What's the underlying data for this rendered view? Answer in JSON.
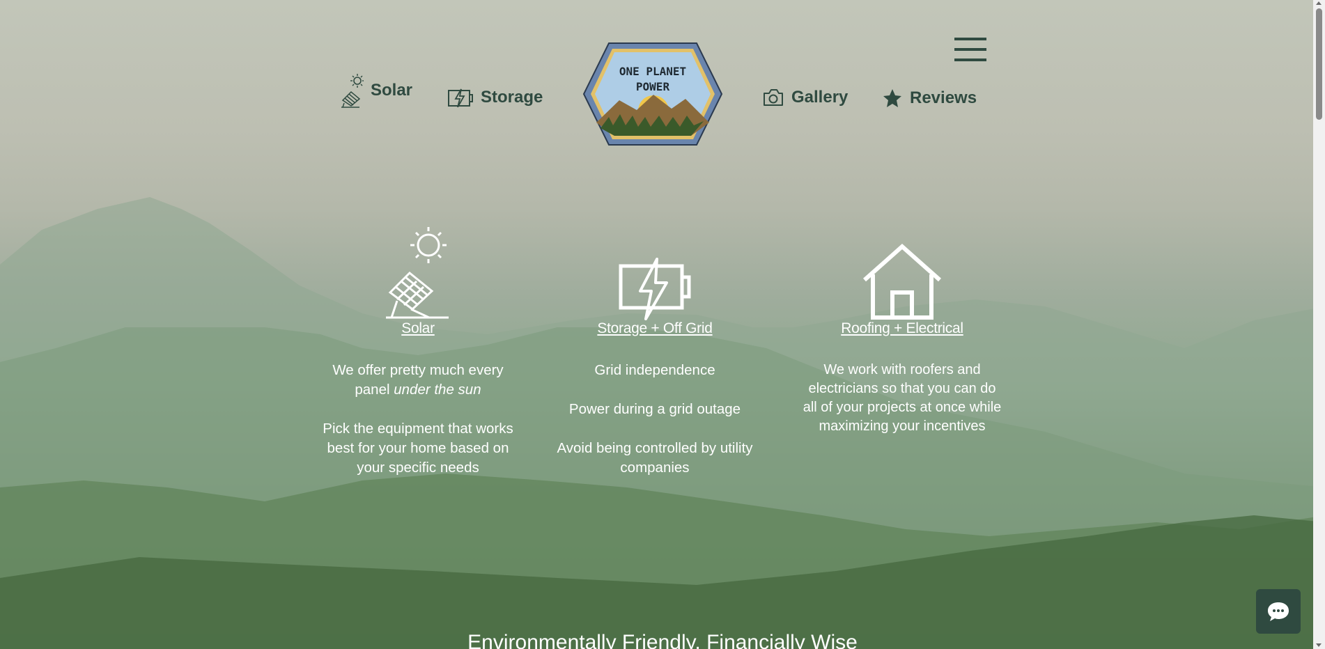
{
  "nav": {
    "solar_label": "Solar",
    "storage_label": "Storage",
    "gallery_label": "Gallery",
    "reviews_label": "Reviews",
    "logo_text_line1": "ONE PLANET",
    "logo_text_line2": "POWER"
  },
  "features": {
    "solar": {
      "title": "Solar",
      "line1": "We offer pretty much every panel ",
      "line1_italic": "under the sun",
      "line2": "Pick the equipment that works best for your home based on your specific needs"
    },
    "storage": {
      "title": "Storage + Off Grid",
      "line1": "Grid independence",
      "line2": "Power during a grid outage",
      "line3": "Avoid being controlled by utility companies"
    },
    "roofing": {
      "title": "Roofing + Electrical",
      "line1": "We work with roofers and electricians so that you can do all of your projects at once while maximizing your incentives"
    }
  },
  "tagline": "Environmentally Friendly, Financially Wise",
  "colors": {
    "nav_text": "#2f4a40",
    "feature_text": "#ffffff",
    "chat_button": "#2f4a40"
  },
  "icons": {
    "solar": "solar-panel-icon",
    "storage": "battery-bolt-icon",
    "gallery": "camera-icon",
    "reviews": "star-icon",
    "roofing": "house-icon",
    "menu": "hamburger-menu-icon",
    "chat": "chat-bubble-icon"
  }
}
